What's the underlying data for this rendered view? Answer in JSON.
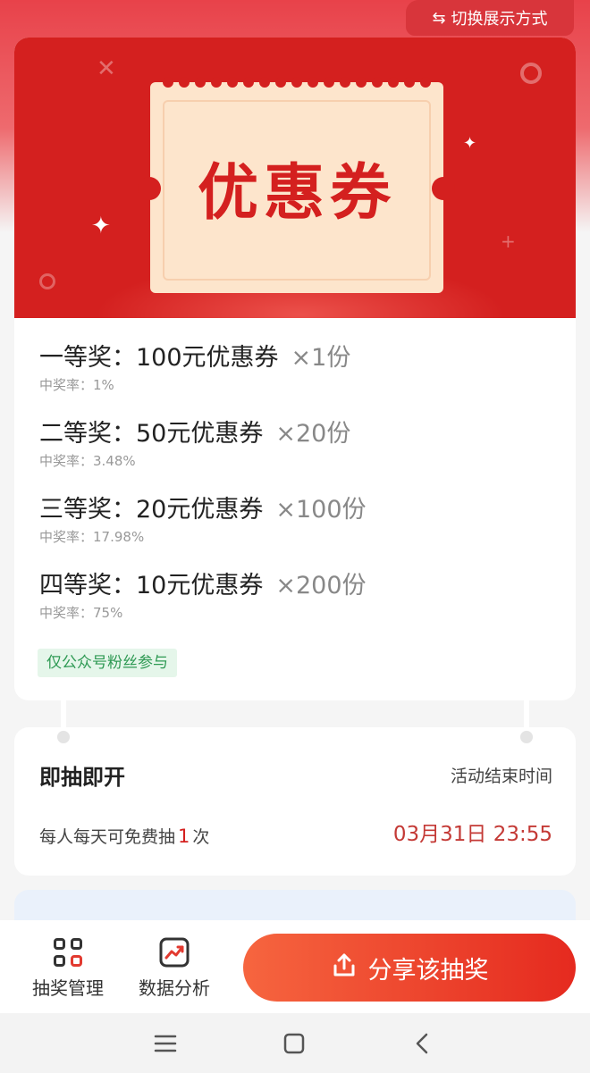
{
  "header": {
    "switch_label": "切换展示方式",
    "switch_icon": "swap-icon"
  },
  "banner": {
    "coupon_title": "优惠券",
    "background_color": "#d4201f",
    "coupon_color": "#fde5cc"
  },
  "prizes": [
    {
      "label": "一等奖：100元优惠券",
      "qty": "×1份",
      "rate": "中奖率：1%"
    },
    {
      "label": "二等奖：50元优惠券",
      "qty": "×20份",
      "rate": "中奖率：3.48%"
    },
    {
      "label": "三等奖：20元优惠券",
      "qty": "×100份",
      "rate": "中奖率：17.98%"
    },
    {
      "label": "四等奖：10元优惠券",
      "qty": "×200份",
      "rate": "中奖率：75%"
    }
  ],
  "fans_tag": "仅公众号粉丝参与",
  "info": {
    "title": "即抽即开",
    "end_label": "活动结束时间",
    "draws_prefix": "每人每天可免费抽",
    "draws_count": "1",
    "draws_suffix": "次",
    "end_time": "03月31日 23:55"
  },
  "bottom_nav": {
    "manage_label": "抽奖管理",
    "data_label": "数据分析",
    "share_label": "分享该抽奖",
    "share_color_start": "#f6653f",
    "share_color_end": "#e52a1f"
  },
  "system_nav": {
    "menu_icon": "menu-icon",
    "home_icon": "home-icon",
    "back_icon": "back-icon"
  }
}
